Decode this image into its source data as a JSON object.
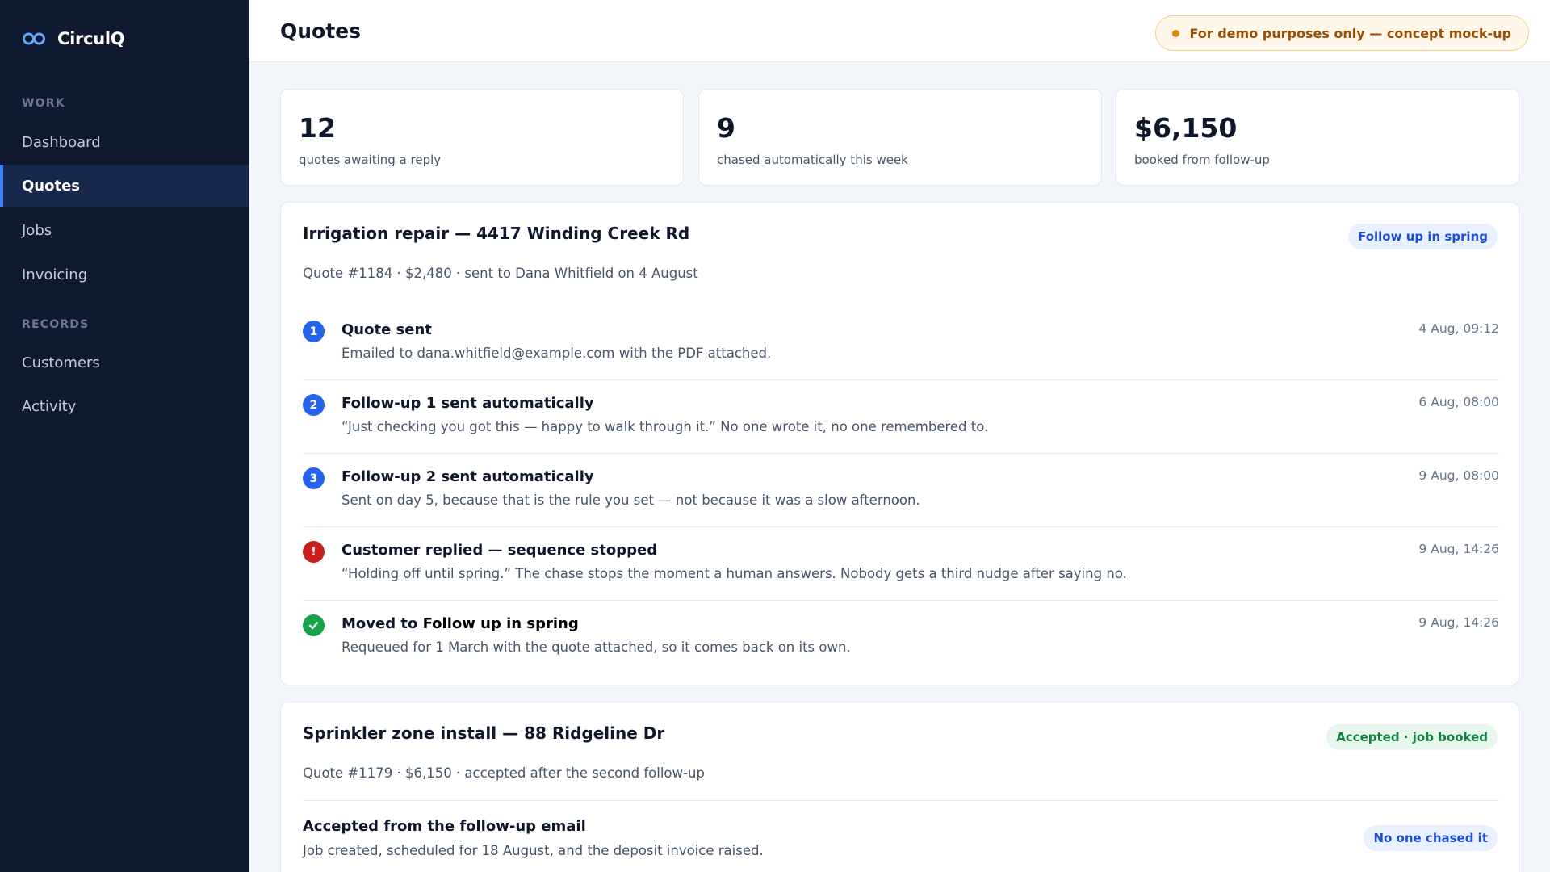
{
  "app": {
    "name": "CirculQ",
    "logo_icon": "infinity-loop-icon",
    "accent": "#3b82f6",
    "sidebar_bg": "#0f1a30"
  },
  "sidebar": {
    "sections": [
      {
        "label": "WORK",
        "items": [
          {
            "label": "Dashboard",
            "active": false
          },
          {
            "label": "Quotes",
            "active": true
          },
          {
            "label": "Jobs",
            "active": false
          },
          {
            "label": "Invoicing",
            "active": false
          }
        ]
      },
      {
        "label": "RECORDS",
        "items": [
          {
            "label": "Customers",
            "active": false
          },
          {
            "label": "Activity",
            "active": false
          }
        ]
      }
    ]
  },
  "header": {
    "title": "Quotes",
    "demo_notice": "For demo purposes only — concept mock-up"
  },
  "stats": [
    {
      "value": "12",
      "label": "quotes awaiting a reply"
    },
    {
      "value": "9",
      "label": "chased automatically this week"
    },
    {
      "value": "$6,150",
      "label": "booked from follow-up"
    }
  ],
  "quotes": [
    {
      "title": "Irrigation repair — 4417 Winding Creek Rd",
      "meta": "Quote #1184 · $2,480 · sent to Dana Whitfield on 4 August",
      "badge": "Follow up in spring",
      "badge_color": "#1d4ed8",
      "timeline": [
        {
          "marker": "1",
          "marker_type": "number",
          "title": "Quote sent",
          "desc": "Emailed to dana.whitfield@example.com with the PDF attached.",
          "time": "4 Aug, 09:12"
        },
        {
          "marker": "2",
          "marker_type": "number",
          "title": "Follow-up 1 sent automatically",
          "desc": "“Just checking you got this — happy to walk through it.” No one wrote it, no one remembered to.",
          "time": "6 Aug, 08:00"
        },
        {
          "marker": "3",
          "marker_type": "number",
          "title": "Follow-up 2 sent automatically",
          "desc": "Sent on day 5, because that is the rule you set — not because it was a slow afternoon.",
          "time": "9 Aug, 08:00"
        },
        {
          "marker": "!",
          "marker_type": "alert",
          "title": "Customer replied — sequence stopped",
          "desc": "“Holding off until spring.” The chase stops the moment a human answers. Nobody gets a third nudge after saying no.",
          "time": "9 Aug, 14:26"
        },
        {
          "marker": "check-icon",
          "marker_type": "check",
          "title_prefix": "Moved to ",
          "title_strong": "Follow up in spring",
          "desc": "Requeued for 1 March with the quote attached, so it comes back on its own.",
          "time": "9 Aug, 14:26"
        }
      ]
    },
    {
      "title": "Sprinkler zone install — 88 Ridgeline Dr",
      "meta": "Quote #1179 · $6,150 · accepted after the second follow-up",
      "badge": "Accepted · job booked",
      "badge_color": "#15803d",
      "sub": {
        "title": "Accepted from the follow-up email",
        "desc": "Job created, scheduled for 18 August, and the deposit invoice raised.",
        "badge": "No one chased it"
      }
    }
  ]
}
